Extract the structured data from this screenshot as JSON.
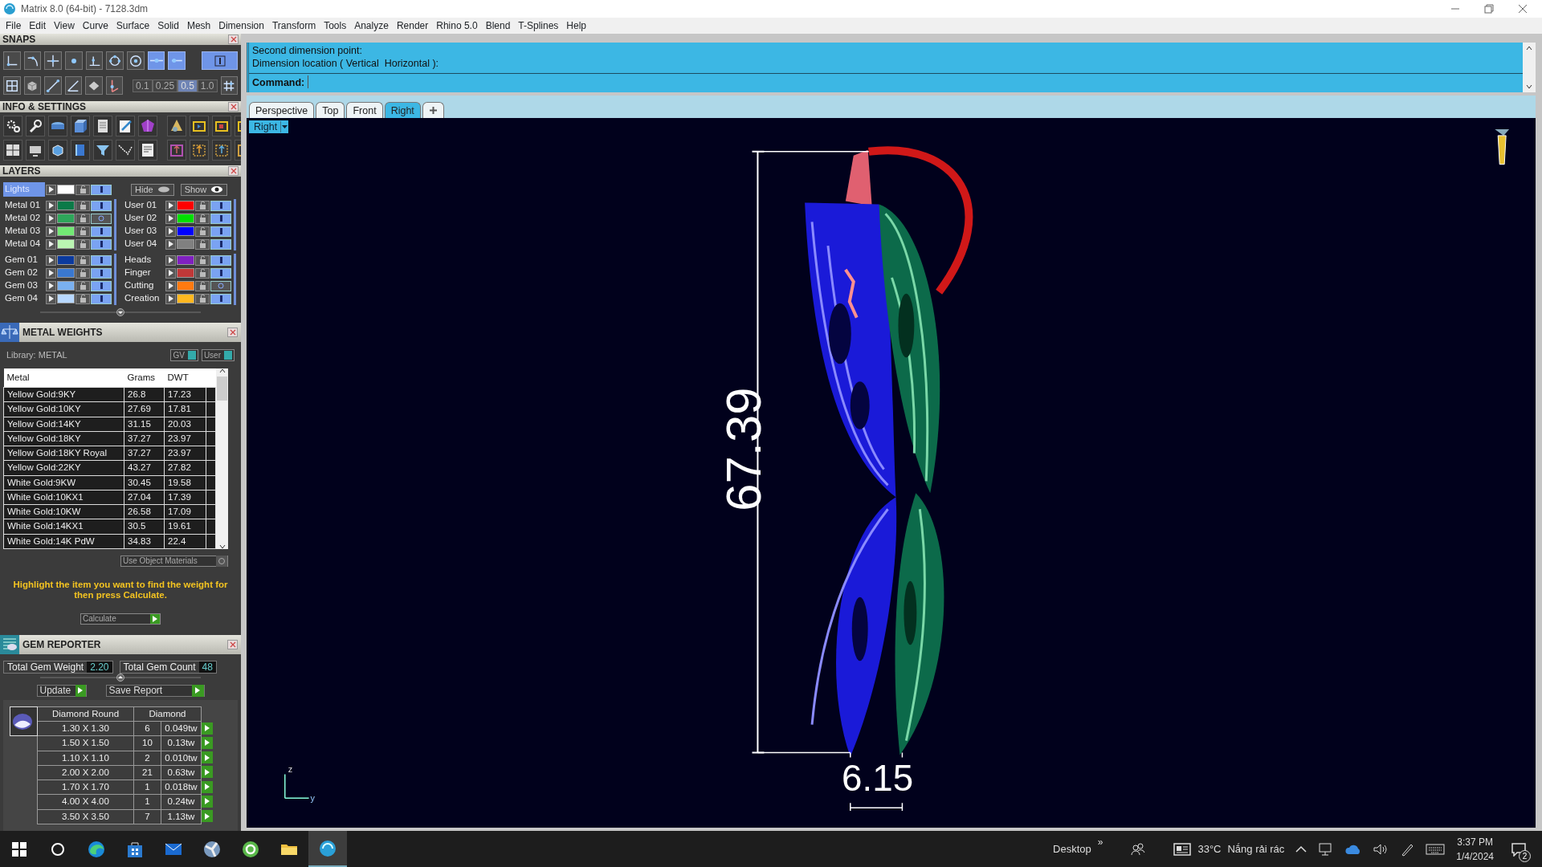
{
  "window": {
    "title": "Matrix 8.0 (64-bit) - 7128.3dm"
  },
  "menu": [
    "File",
    "Edit",
    "View",
    "Curve",
    "Surface",
    "Solid",
    "Mesh",
    "Dimension",
    "Transform",
    "Tools",
    "Analyze",
    "Render",
    "Rhino 5.0",
    "Blend",
    "T-Splines",
    "Help"
  ],
  "snaps": {
    "title": "SNAPS",
    "row1": [
      {
        "on": false
      },
      {
        "on": false
      },
      {
        "on": false
      },
      {
        "on": false
      },
      {
        "on": false
      },
      {
        "on": false
      },
      {
        "on": false
      },
      {
        "on": true
      },
      {
        "on": true
      }
    ],
    "big_toggle": {
      "on": true
    },
    "increments": [
      {
        "label": "0.1",
        "selected": false
      },
      {
        "label": "0.25",
        "selected": false
      },
      {
        "label": "0.5",
        "selected": true
      },
      {
        "label": "1.0",
        "selected": false
      }
    ]
  },
  "info_settings": {
    "title": "INFO & SETTINGS"
  },
  "layers": {
    "title": "LAYERS",
    "lights": {
      "name": "Lights",
      "color": "#ffffff",
      "visible": true,
      "selected": true
    },
    "hide": "Hide",
    "show": "Show",
    "sections": [
      {
        "left": [
          {
            "name": "Metal 01",
            "color": "#0b7a48",
            "visible": true
          },
          {
            "name": "Metal 02",
            "color": "#2ea65a",
            "visible": false
          },
          {
            "name": "Metal 03",
            "color": "#72e874",
            "visible": true
          },
          {
            "name": "Metal 04",
            "color": "#baf5b2",
            "visible": true
          }
        ],
        "right": [
          {
            "name": "User 01",
            "color": "#ff0000",
            "visible": true
          },
          {
            "name": "User 02",
            "color": "#00e000",
            "visible": true
          },
          {
            "name": "User 03",
            "color": "#0000ff",
            "visible": true
          },
          {
            "name": "User 04",
            "color": "#808080",
            "visible": true
          }
        ]
      },
      {
        "left": [
          {
            "name": "Gem 01",
            "color": "#0b3a9e",
            "visible": true
          },
          {
            "name": "Gem 02",
            "color": "#3a78d0",
            "visible": true
          },
          {
            "name": "Gem 03",
            "color": "#7ab0f0",
            "visible": true
          },
          {
            "name": "Gem 04",
            "color": "#b8d8ff",
            "visible": true
          }
        ],
        "right": [
          {
            "name": "Heads",
            "color": "#8020c0",
            "visible": true
          },
          {
            "name": "Finger",
            "color": "#c03838",
            "visible": true
          },
          {
            "name": "Cutting",
            "color": "#ff7a10",
            "visible": false
          },
          {
            "name": "Creation",
            "color": "#ffb820",
            "visible": true
          }
        ]
      }
    ]
  },
  "metal_weights": {
    "title": "METAL WEIGHTS",
    "library": "Library: METAL",
    "toggles": [
      {
        "label": "GV",
        "on": true
      },
      {
        "label": "User",
        "on": true
      }
    ],
    "columns": [
      "Metal",
      "Grams",
      "DWT"
    ],
    "rows": [
      [
        "Yellow Gold:9KY",
        "26.8",
        "17.23"
      ],
      [
        "Yellow Gold:10KY",
        "27.69",
        "17.81"
      ],
      [
        "Yellow Gold:14KY",
        "31.15",
        "20.03"
      ],
      [
        "Yellow Gold:18KY",
        "37.27",
        "23.97"
      ],
      [
        "Yellow Gold:18KY Royal",
        "37.27",
        "23.97"
      ],
      [
        "Yellow Gold:22KY",
        "43.27",
        "27.82"
      ],
      [
        "White Gold:9KW",
        "30.45",
        "19.58"
      ],
      [
        "White Gold:10KX1",
        "27.04",
        "17.39"
      ],
      [
        "White Gold:10KW",
        "26.58",
        "17.09"
      ],
      [
        "White Gold:14KX1",
        "30.5",
        "19.61"
      ],
      [
        "White Gold:14K PdW",
        "34.83",
        "22.4"
      ]
    ],
    "use_object_materials": {
      "label": "Use Object Materials",
      "on": false
    },
    "hint": "Highlight the item you want to find the weight for then press Calculate.",
    "calculate": "Calculate"
  },
  "gem_reporter": {
    "title": "GEM REPORTER",
    "totals": [
      {
        "label": "Total Gem Weight",
        "value": "2.20"
      },
      {
        "label": "Total Gem Count",
        "value": "48"
      }
    ],
    "actions": [
      "Update",
      "Save Report"
    ],
    "shape": "Diamond Round",
    "material": "Diamond",
    "rows": [
      {
        "size": "1.30 X 1.30",
        "count": "6",
        "weight": "0.049tw"
      },
      {
        "size": "1.50 X 1.50",
        "count": "10",
        "weight": "0.13tw"
      },
      {
        "size": "1.10 X 1.10",
        "count": "2",
        "weight": "0.010tw"
      },
      {
        "size": "2.00 X 2.00",
        "count": "21",
        "weight": "0.63tw"
      },
      {
        "size": "1.70 X 1.70",
        "count": "1",
        "weight": "0.018tw"
      },
      {
        "size": "4.00 X 4.00",
        "count": "1",
        "weight": "0.24tw"
      },
      {
        "size": "3.50 X 3.50",
        "count": "7",
        "weight": "1.13tw"
      }
    ]
  },
  "command": {
    "history": [
      "Second dimension point:",
      "Dimension location ( Vertical  Horizontal ):"
    ],
    "prompt": "Command:"
  },
  "viewport_tabs": [
    {
      "label": "Perspective",
      "selected": false
    },
    {
      "label": "Top",
      "selected": false
    },
    {
      "label": "Front",
      "selected": false
    },
    {
      "label": "Right",
      "selected": true
    }
  ],
  "viewport": {
    "name": "Right",
    "vertical_dimension": "67.39",
    "horizontal_dimension": "6.15",
    "axes": [
      "z",
      "y"
    ]
  },
  "taskbar": {
    "apps": [
      {
        "selected": false
      },
      {
        "selected": false
      },
      {
        "selected": false
      },
      {
        "selected": false
      },
      {
        "selected": false
      },
      {
        "selected": false
      },
      {
        "selected": true
      }
    ],
    "desktop": "Desktop",
    "overflow": "»",
    "temperature": "33°C",
    "weather": "Nắng rải rác",
    "time": "3:37 PM",
    "date": "1/4/2024",
    "notifications": "2"
  }
}
